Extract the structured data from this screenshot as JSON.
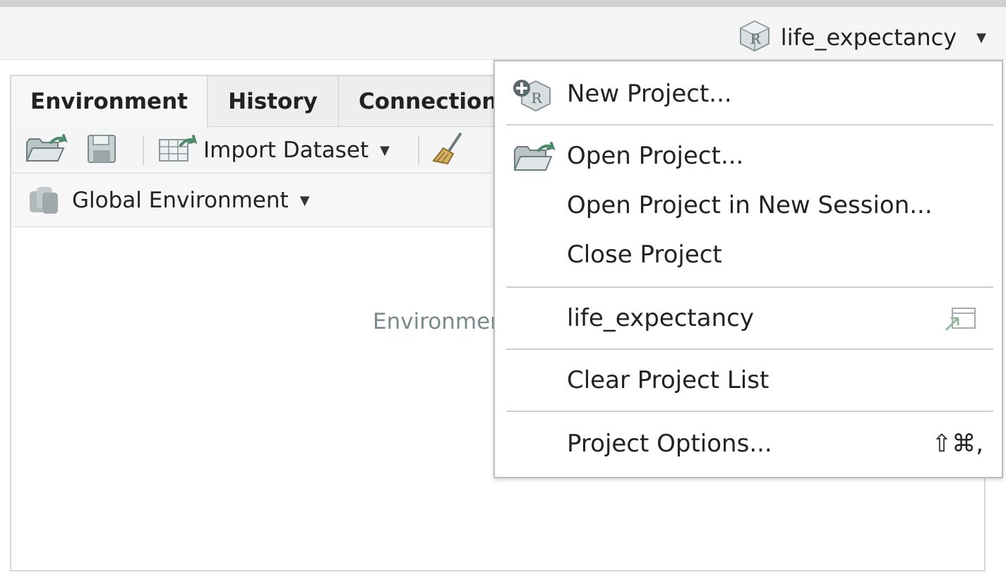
{
  "header": {
    "project_name": "life_expectancy",
    "project_icon": "r-project-icon",
    "dropdown_icon": "caret-down-icon"
  },
  "pane": {
    "tabs": [
      {
        "label": "Environment",
        "active": true
      },
      {
        "label": "History",
        "active": false
      },
      {
        "label": "Connections",
        "active": false
      }
    ],
    "toolbar": {
      "import_dataset_label": "Import Dataset",
      "icons": [
        "open-folder-icon",
        "save-icon",
        "import-dataset-icon",
        "broom-icon"
      ]
    },
    "environment_selector": "Global Environment",
    "empty_message": "Environment is empty"
  },
  "project_menu": {
    "items": [
      {
        "label": "New Project...",
        "icon": "new-project-icon"
      },
      {
        "label": "Open Project...",
        "icon": "open-folder-icon"
      },
      {
        "label": "Open Project in New Session..."
      },
      {
        "label": "Close Project"
      },
      {
        "label": "life_expectancy",
        "icon": "open-in-new-session-icon"
      },
      {
        "label": "Clear Project List"
      },
      {
        "label": "Project Options...",
        "shortcut": "⇧⌘,"
      }
    ]
  },
  "colors": {
    "toolbar_bg": "#f5f5f5",
    "tab_bg": "#eeeeee",
    "muted_text": "#7a8a8c",
    "green_accent": "#4d8a6a"
  }
}
